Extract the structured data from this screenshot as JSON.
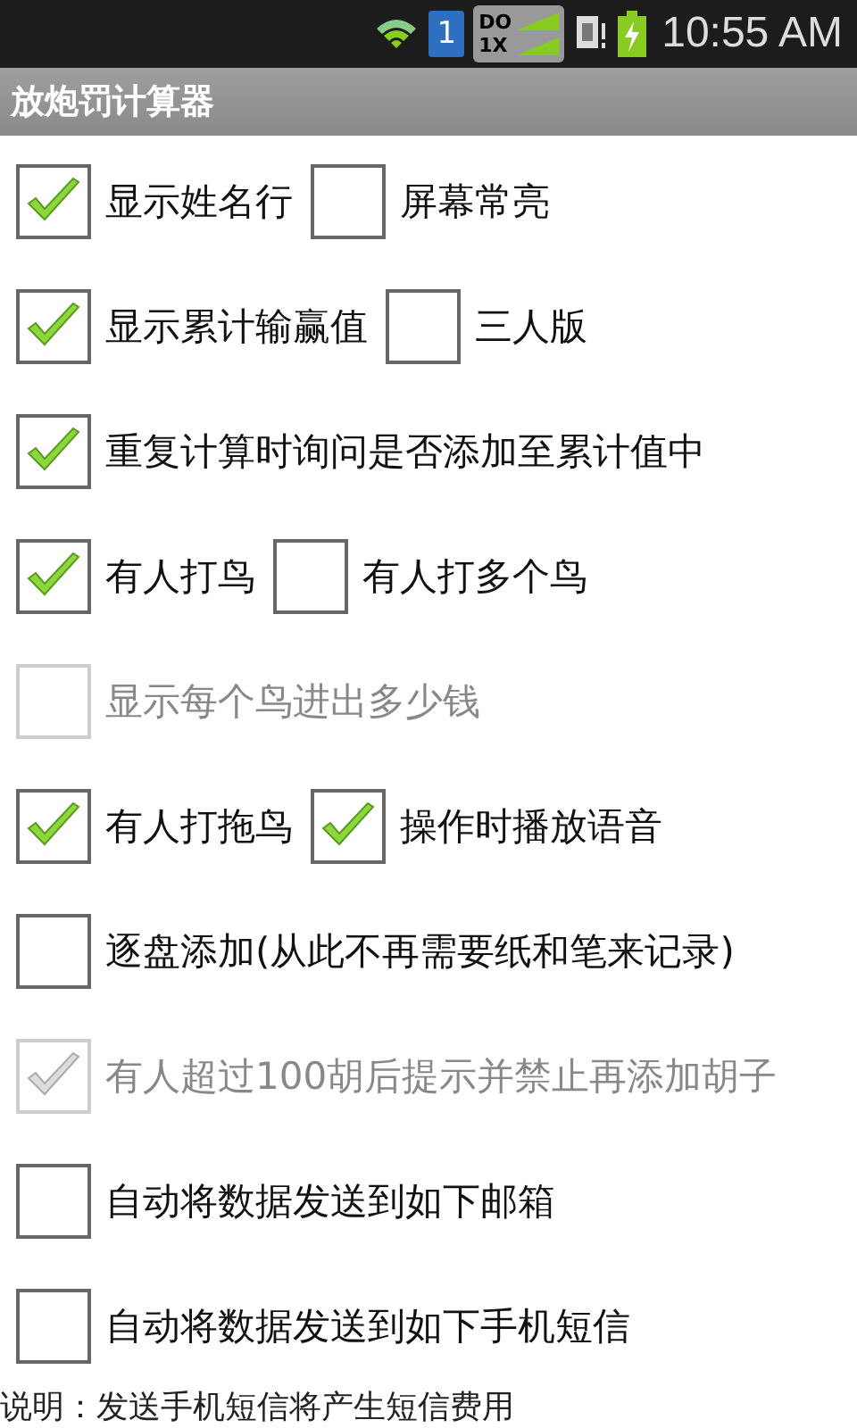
{
  "status_bar": {
    "sim_slot": "1",
    "network_top": "DO",
    "network_bottom": "1X",
    "time": "10:55 AM"
  },
  "title_bar": {
    "title": "放炮罚计算器"
  },
  "rows": [
    {
      "options": [
        {
          "label": "显示姓名行",
          "checked": true,
          "disabled": false
        },
        {
          "label": "屏幕常亮",
          "checked": false,
          "disabled": false
        }
      ]
    },
    {
      "options": [
        {
          "label": "显示累计输赢值",
          "checked": true,
          "disabled": false
        },
        {
          "label": "三人版",
          "checked": false,
          "disabled": false
        }
      ]
    },
    {
      "options": [
        {
          "label": "重复计算时询问是否添加至累计值中",
          "checked": true,
          "disabled": false
        }
      ]
    },
    {
      "options": [
        {
          "label": "有人打鸟",
          "checked": true,
          "disabled": false
        },
        {
          "label": "有人打多个鸟",
          "checked": false,
          "disabled": false
        }
      ]
    },
    {
      "options": [
        {
          "label": "显示每个鸟进出多少钱",
          "checked": false,
          "disabled": true
        }
      ]
    },
    {
      "options": [
        {
          "label": "有人打拖鸟",
          "checked": true,
          "disabled": false
        },
        {
          "label": "操作时播放语音",
          "checked": true,
          "disabled": false
        }
      ]
    },
    {
      "options": [
        {
          "label": "逐盘添加(从此不再需要纸和笔来记录)",
          "checked": false,
          "disabled": false
        }
      ]
    },
    {
      "options": [
        {
          "label": "有人超过100胡后提示并禁止再添加胡子",
          "checked": true,
          "disabled": true
        }
      ]
    },
    {
      "options": [
        {
          "label": "自动将数据发送到如下邮箱",
          "checked": false,
          "disabled": false
        }
      ]
    },
    {
      "options": [
        {
          "label": "自动将数据发送到如下手机短信",
          "checked": false,
          "disabled": false
        }
      ]
    }
  ],
  "note": "说明：发送手机短信将产生短信费用"
}
